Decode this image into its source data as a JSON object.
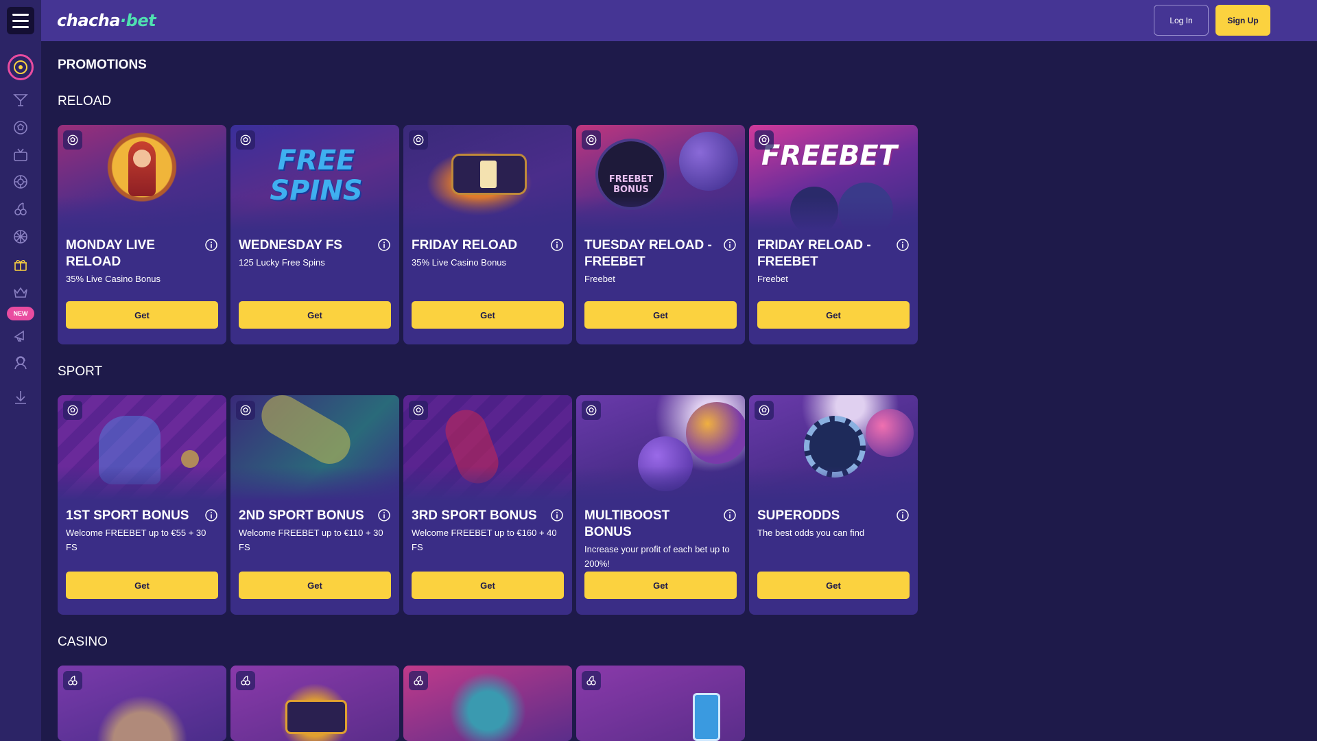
{
  "header": {
    "logo_main": "chacha",
    "logo_dot": "·",
    "logo_suffix": "bet",
    "login_label": "Log In",
    "signup_label": "Sign Up"
  },
  "sidebar": {
    "new_badge": "NEW",
    "items": [
      "target-icon",
      "cocktail-icon",
      "soccer-ball-icon",
      "live-tv-icon",
      "roulette-icon",
      "cherries-icon",
      "wheel-icon",
      "gift-icon",
      "crown-icon",
      "megaphone-icon",
      "support-agent-icon",
      "download-icon"
    ]
  },
  "page": {
    "title": "PROMOTIONS"
  },
  "sections": [
    {
      "title": "RELOAD",
      "cards": [
        {
          "title": "MONDAY LIVE RELOAD",
          "subtitle": "35% Live Casino Bonus",
          "button": "Get",
          "icon": "soccer-ball-icon",
          "art_text": ""
        },
        {
          "title": "WEDNESDAY FS",
          "subtitle": "125 Lucky Free Spins",
          "button": "Get",
          "icon": "soccer-ball-icon",
          "art_text": "FREE SPINS"
        },
        {
          "title": "FRIDAY RELOAD",
          "subtitle": "35% Live Casino Bonus",
          "button": "Get",
          "icon": "soccer-ball-icon",
          "art_text": ""
        },
        {
          "title": "TUESDAY RELOAD - FREEBET",
          "subtitle": "Freebet",
          "button": "Get",
          "icon": "soccer-ball-icon",
          "art_text": "FREEBET BONUS"
        },
        {
          "title": "FRIDAY RELOAD - FREEBET",
          "subtitle": "Freebet",
          "button": "Get",
          "icon": "soccer-ball-icon",
          "art_text": "FREEBET"
        }
      ]
    },
    {
      "title": "SPORT",
      "cards": [
        {
          "title": "1ST SPORT BONUS",
          "subtitle": "Welcome FREEBET up to €55 + 30 FS",
          "button": "Get",
          "icon": "soccer-ball-icon",
          "art_text": ""
        },
        {
          "title": "2ND SPORT BONUS",
          "subtitle": "Welcome FREEBET up to €110 + 30 FS",
          "button": "Get",
          "icon": "soccer-ball-icon",
          "art_text": ""
        },
        {
          "title": "3RD SPORT BONUS",
          "subtitle": "Welcome FREEBET up to €160 + 40 FS",
          "button": "Get",
          "icon": "soccer-ball-icon",
          "art_text": ""
        },
        {
          "title": "MULTIBOOST BONUS",
          "subtitle": "Increase your profit of each bet up to 200%!",
          "button": "Get",
          "icon": "soccer-ball-icon",
          "art_text": ""
        },
        {
          "title": "SUPERODDS",
          "subtitle": "The best odds you can find",
          "button": "Get",
          "icon": "soccer-ball-icon",
          "art_text": ""
        }
      ]
    },
    {
      "title": "CASINO",
      "cards": [
        {
          "icon": "cherries-icon"
        },
        {
          "icon": "cherries-icon"
        },
        {
          "icon": "cherries-icon"
        },
        {
          "icon": "cherries-icon"
        }
      ]
    }
  ],
  "colors": {
    "background": "#1e1a4a",
    "topbar": "#453594",
    "sidebar": "#2c2466",
    "card": "#3a2d86",
    "accent_yellow": "#fbd23f",
    "accent_pink": "#e94ca0",
    "accent_green": "#4fe0b0"
  }
}
